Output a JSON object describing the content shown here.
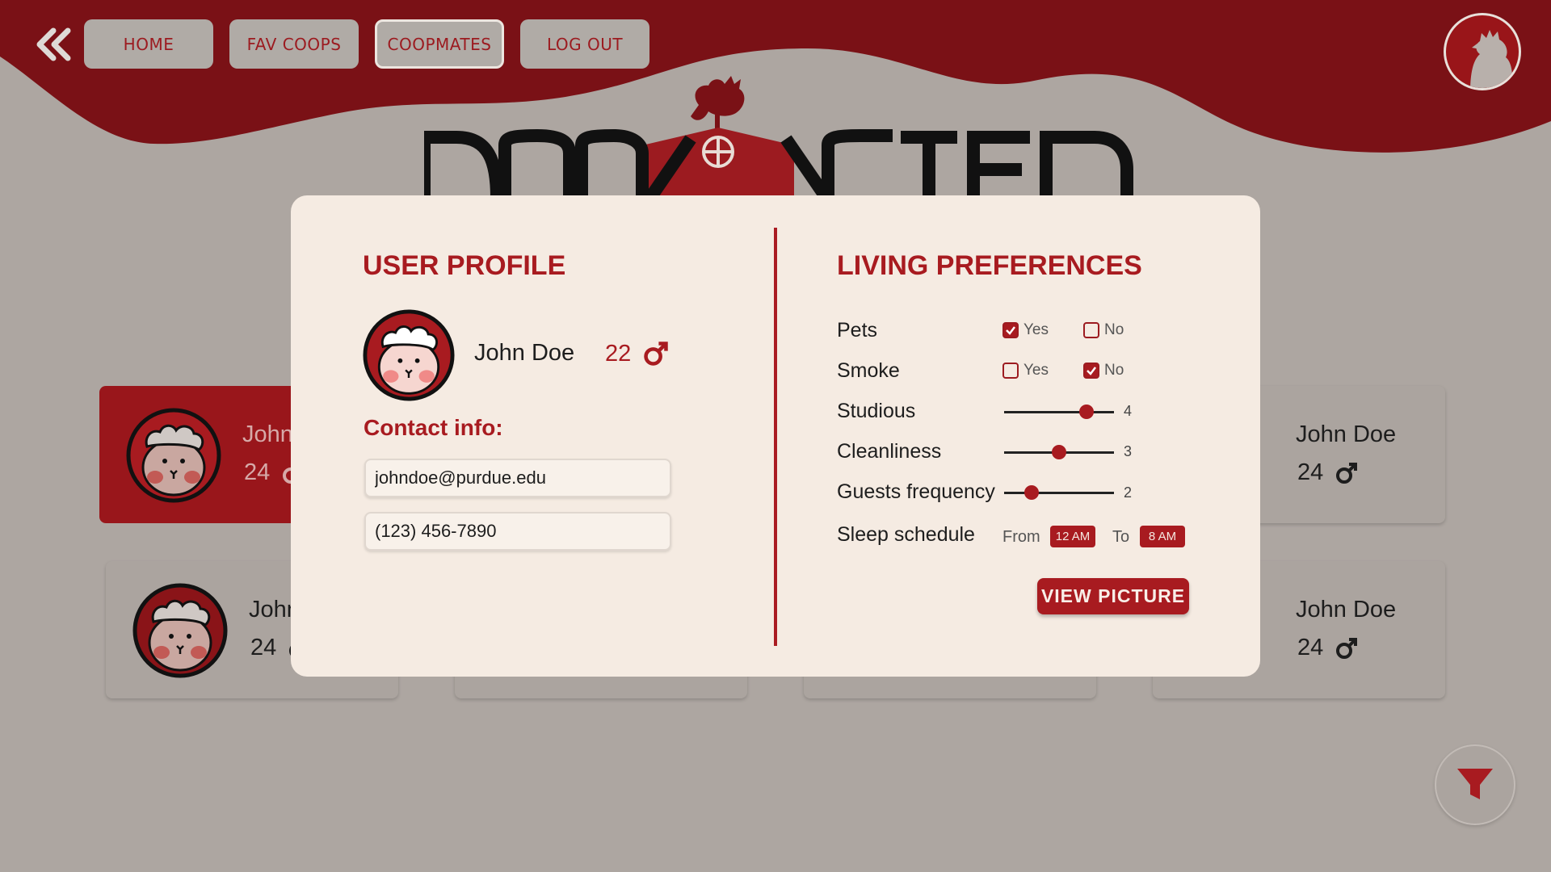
{
  "colors": {
    "brand": "#a81b20",
    "header": "#7a1116",
    "background": "#ada6a1",
    "panel": "#f5ebe2"
  },
  "nav": {
    "back_icon": "double-chevron-left-icon",
    "items": [
      {
        "label": "HOME"
      },
      {
        "label": "FAV COOPS"
      },
      {
        "label": "COOPMATES",
        "active": true
      },
      {
        "label": "LOG OUT"
      }
    ],
    "avatar_icon": "rooster-avatar-icon"
  },
  "cards": [
    {
      "name": "John Doe",
      "age": "24",
      "gender_icon": "male-icon",
      "selected": true
    },
    {
      "name": "John Doe",
      "age": "24",
      "gender_icon": "male-icon"
    },
    {
      "name": "John Doe",
      "age": "24",
      "gender_icon": "male-icon"
    },
    {
      "name": "John Doe",
      "age": "24",
      "gender_icon": "male-icon"
    }
  ],
  "filter": {
    "icon": "filter-icon"
  },
  "profile": {
    "heading": "USER PROFILE",
    "name": "John Doe",
    "age": "22",
    "gender_icon": "male-icon",
    "contact_label": "Contact info:",
    "email": "johndoe@purdue.edu",
    "phone": "(123) 456-7890"
  },
  "preferences": {
    "heading": "LIVING PREFERENCES",
    "pets": {
      "label": "Pets",
      "yes_label": "Yes",
      "no_label": "No",
      "value": "Yes"
    },
    "smoke": {
      "label": "Smoke",
      "yes_label": "Yes",
      "no_label": "No",
      "value": "No"
    },
    "studious": {
      "label": "Studious",
      "value": "4",
      "level": 0.75
    },
    "cleanliness": {
      "label": "Cleanliness",
      "value": "3",
      "level": 0.5
    },
    "guests": {
      "label": "Guests frequency",
      "value": "2",
      "level": 0.25
    },
    "sleep": {
      "label": "Sleep schedule",
      "from_label": "From",
      "from": "12 AM",
      "to_label": "To",
      "to": "8 AM"
    },
    "view_button": "VIEW PICTURE"
  }
}
